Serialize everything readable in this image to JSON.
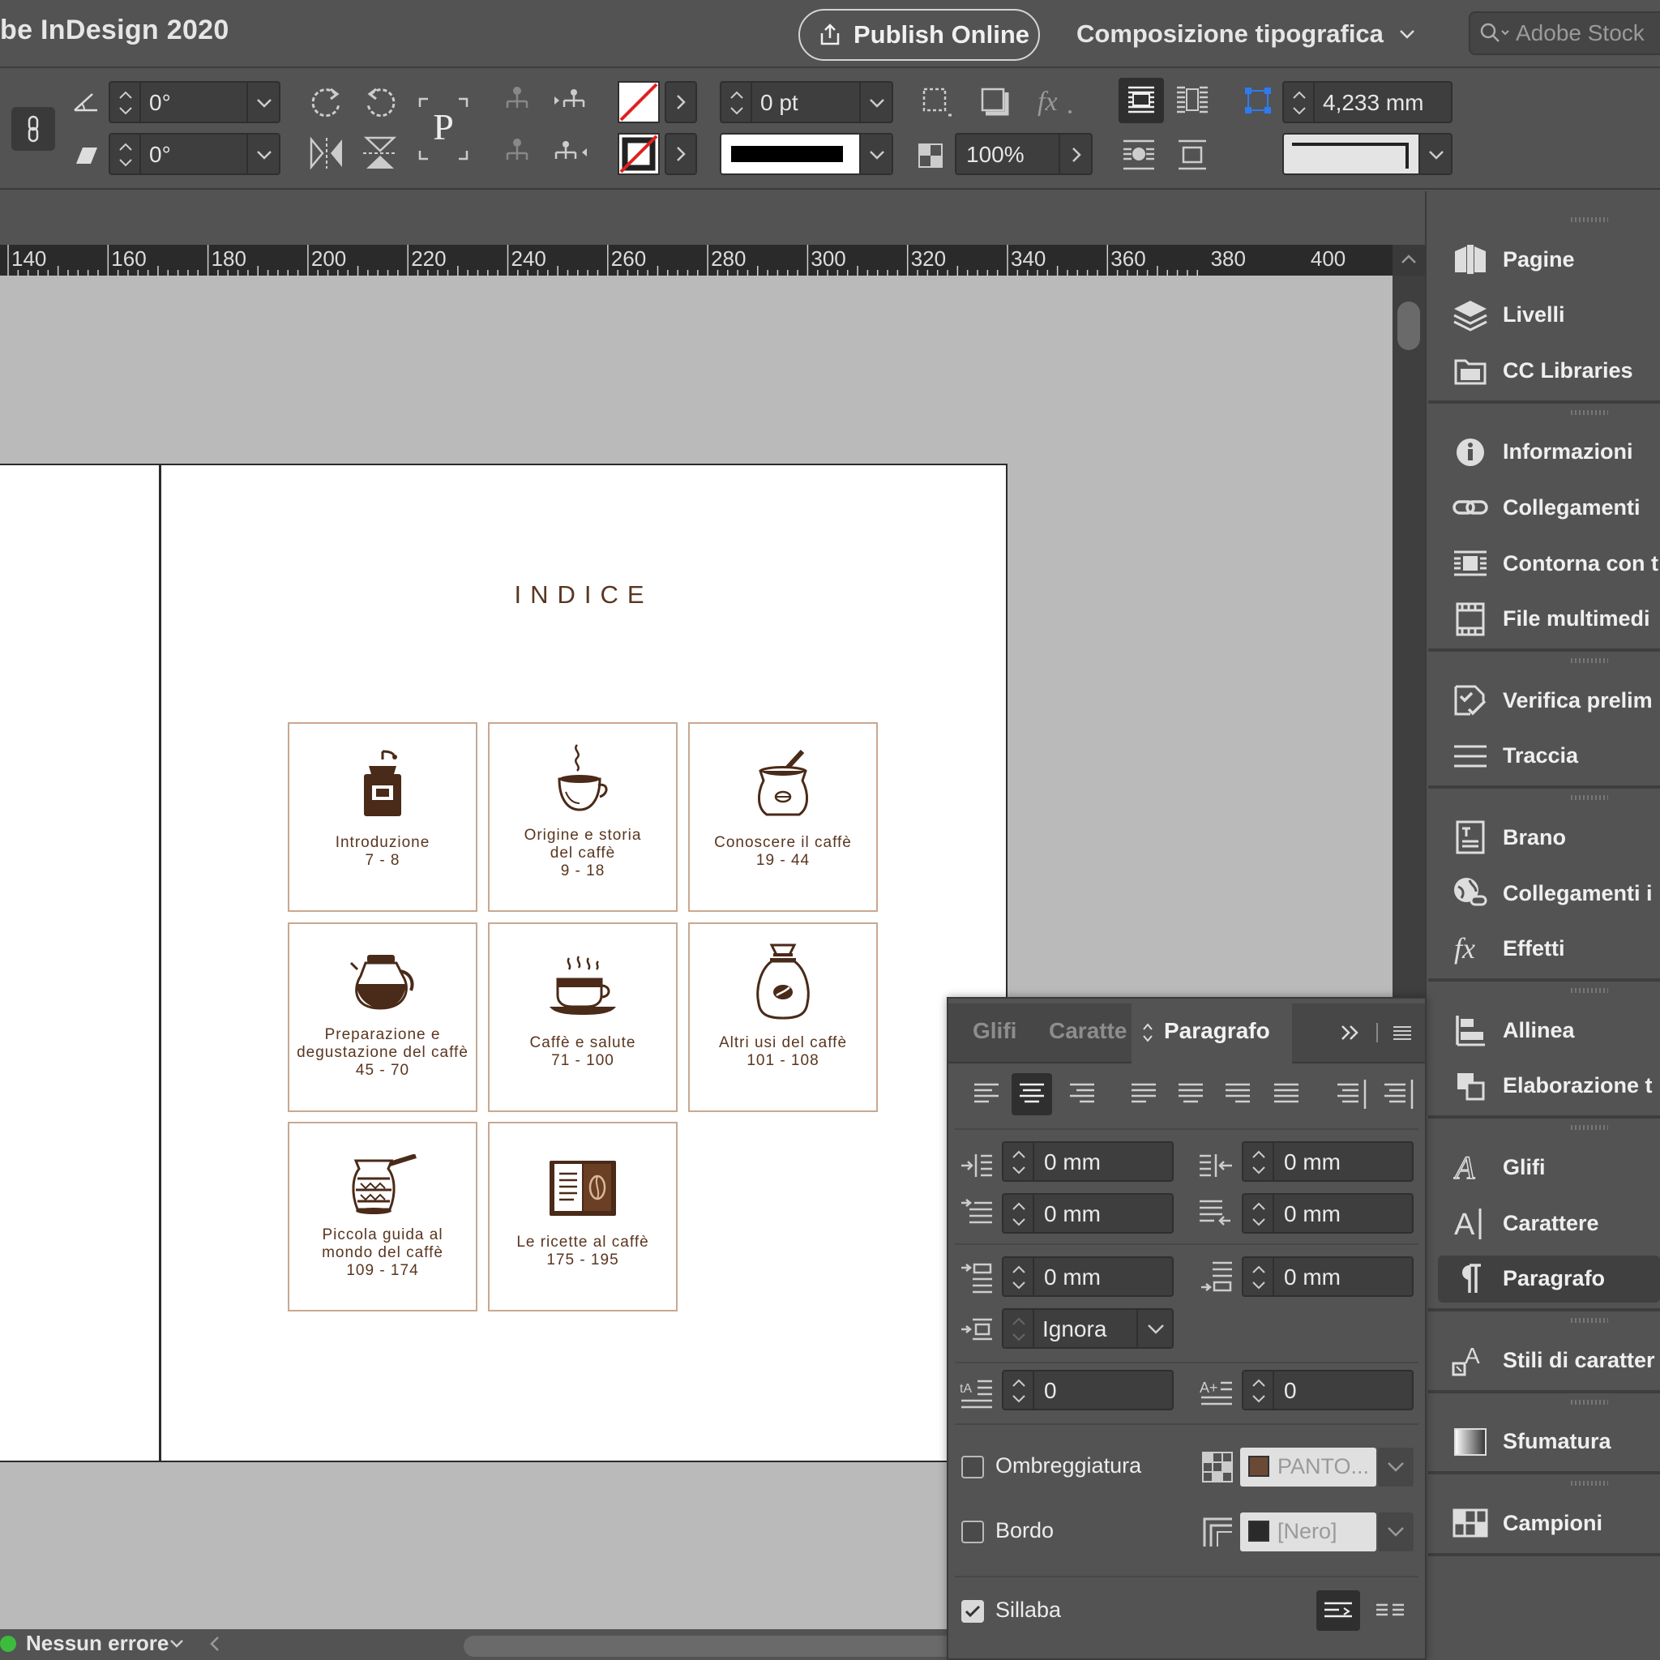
{
  "app": {
    "title": "be InDesign 2020",
    "publish_label": "Publish Online",
    "workspace_label": "Composizione tipografica",
    "stock_placeholder": "Adobe Stock"
  },
  "control_bar": {
    "rotate_angle": "0°",
    "shear_angle": "0°",
    "stroke_weight": "0 pt",
    "opacity": "100%",
    "gap_value": "4,233 mm"
  },
  "ruler": {
    "labels": [
      "140",
      "160",
      "180",
      "200",
      "220",
      "240",
      "260",
      "280",
      "300",
      "320",
      "340",
      "360",
      "380",
      "400"
    ]
  },
  "document": {
    "title": "INDICE",
    "cards": [
      {
        "label": "Introduzione\n7 - 8",
        "icon": "coffee-grinder-icon"
      },
      {
        "label": "Origine e storia\ndel caffè\n9 - 18",
        "icon": "coffee-cup-icon"
      },
      {
        "label": "Conoscere il caffè\n19 - 44",
        "icon": "coffee-sack-scoop-icon"
      },
      {
        "label": "Preparazione e\ndegustazione del caffè\n45 - 70",
        "icon": "coffee-pot-icon"
      },
      {
        "label": "Caffè e salute\n71 - 100",
        "icon": "steaming-cup-icon"
      },
      {
        "label": "Altri usi del caffè\n101 - 108",
        "icon": "coffee-bag-icon"
      },
      {
        "label": "Piccola guida al\nmondo del caffè\n109 - 174",
        "icon": "cezve-icon"
      },
      {
        "label": "Le ricette al caffè\n175 - 195",
        "icon": "recipe-book-icon"
      }
    ]
  },
  "status": {
    "preflight": "Nessun errore"
  },
  "dock": {
    "groups": [
      [
        "Pagine",
        "Livelli",
        "CC Libraries"
      ],
      [
        "Informazioni",
        "Collegamenti",
        "Contorna con t",
        "File multimedi"
      ],
      [
        "Verifica prelim",
        "Traccia"
      ],
      [
        "Brano",
        "Collegamenti i",
        "Effetti"
      ],
      [
        "Allinea",
        "Elaborazione t"
      ],
      [
        "Glifi",
        "Carattere",
        "Paragrafo"
      ],
      [
        "Stili di caratter"
      ],
      [
        "Sfumatura"
      ],
      [
        "Campioni"
      ]
    ],
    "active": "Paragrafo"
  },
  "paragraph_panel": {
    "tabs": [
      "Glifi",
      "Caratte",
      "Paragrafo"
    ],
    "active_tab": "Paragrafo",
    "left_indent": "0 mm",
    "right_indent": "0 mm",
    "first_line_indent": "0 mm",
    "last_line_indent": "0 mm",
    "space_before": "0 mm",
    "space_after": "0 mm",
    "align_to_grid": "Ignora",
    "drop_cap_lines": "0",
    "drop_cap_chars": "0",
    "shading_label": "Ombreggiatura",
    "shading_swatch": "PANTO...",
    "shading_color": "#6b4a35",
    "border_label": "Bordo",
    "border_swatch": "[Nero]",
    "border_color": "#2a2a2a",
    "hyphenate_label": "Sillaba",
    "hyphenate_checked": true,
    "shading_checked": false,
    "border_checked": false
  },
  "colors": {
    "ui_bg": "#535353",
    "pasteboard": "#bababa",
    "accent_text": "#5a3620",
    "status_ok": "#3dbb3d"
  }
}
